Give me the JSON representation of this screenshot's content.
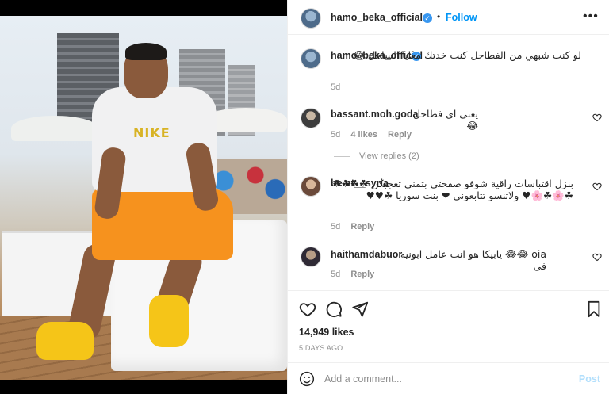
{
  "post": {
    "username": "hamo_beka_official",
    "follow_label": "Follow",
    "separator": "•",
    "caption_username": "hamo_beka_official",
    "caption_text": "لو كنت شبهي من الفطاحل كنت خدتك معايا الساحل 😂",
    "caption_age": "5d"
  },
  "comments": [
    {
      "username": "bassant.moh.goda",
      "text": "يعنى اى فطاحل😂",
      "age": "5d",
      "likes": "4 likes",
      "reply_label": "Reply",
      "view_replies": "View replies (2)"
    },
    {
      "username": "be.nt__syria",
      "text": "بنزل اقتباسات راقية شوفو صفحتي بتمنى تعجبكن ☘☘☘☘☘🌸☘🌸♥ ولاتنسو تتابعوني ❤ بنت سوريا ☘♥♥",
      "age": "5d",
      "reply_label": "Reply"
    },
    {
      "username": "haithamdabuor",
      "text": "oia 😂😂 يابيكا هو انت عامل ابونيه فى",
      "age": "5d",
      "reply_label": "Reply"
    }
  ],
  "photo": {
    "shirt_logo": "NIKE"
  },
  "actions": {
    "likes": "14,949 likes",
    "time_ago": "5 DAYS AGO"
  },
  "add_comment": {
    "placeholder": "Add a comment...",
    "post_label": "Post"
  },
  "icons": [
    "verified-badge-icon",
    "more-options-icon",
    "heart-icon",
    "comment-icon",
    "share-icon",
    "bookmark-icon",
    "emoji-icon"
  ],
  "colors": {
    "accent": "#0095f6",
    "muted": "#8e8e8e",
    "border": "#efefef",
    "post_disabled": "#b2dffc"
  }
}
